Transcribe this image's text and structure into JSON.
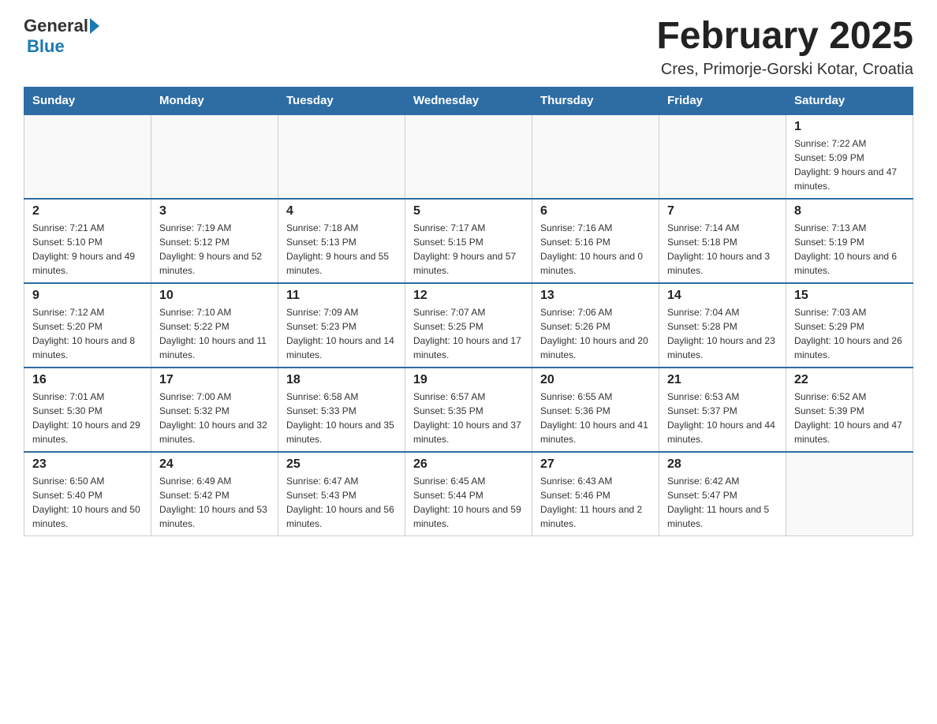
{
  "logo": {
    "text_general": "General",
    "text_blue": "Blue"
  },
  "header": {
    "title": "February 2025",
    "subtitle": "Cres, Primorje-Gorski Kotar, Croatia"
  },
  "days_of_week": [
    "Sunday",
    "Monday",
    "Tuesday",
    "Wednesday",
    "Thursday",
    "Friday",
    "Saturday"
  ],
  "weeks": [
    [
      {
        "day": "",
        "info": ""
      },
      {
        "day": "",
        "info": ""
      },
      {
        "day": "",
        "info": ""
      },
      {
        "day": "",
        "info": ""
      },
      {
        "day": "",
        "info": ""
      },
      {
        "day": "",
        "info": ""
      },
      {
        "day": "1",
        "info": "Sunrise: 7:22 AM\nSunset: 5:09 PM\nDaylight: 9 hours and 47 minutes."
      }
    ],
    [
      {
        "day": "2",
        "info": "Sunrise: 7:21 AM\nSunset: 5:10 PM\nDaylight: 9 hours and 49 minutes."
      },
      {
        "day": "3",
        "info": "Sunrise: 7:19 AM\nSunset: 5:12 PM\nDaylight: 9 hours and 52 minutes."
      },
      {
        "day": "4",
        "info": "Sunrise: 7:18 AM\nSunset: 5:13 PM\nDaylight: 9 hours and 55 minutes."
      },
      {
        "day": "5",
        "info": "Sunrise: 7:17 AM\nSunset: 5:15 PM\nDaylight: 9 hours and 57 minutes."
      },
      {
        "day": "6",
        "info": "Sunrise: 7:16 AM\nSunset: 5:16 PM\nDaylight: 10 hours and 0 minutes."
      },
      {
        "day": "7",
        "info": "Sunrise: 7:14 AM\nSunset: 5:18 PM\nDaylight: 10 hours and 3 minutes."
      },
      {
        "day": "8",
        "info": "Sunrise: 7:13 AM\nSunset: 5:19 PM\nDaylight: 10 hours and 6 minutes."
      }
    ],
    [
      {
        "day": "9",
        "info": "Sunrise: 7:12 AM\nSunset: 5:20 PM\nDaylight: 10 hours and 8 minutes."
      },
      {
        "day": "10",
        "info": "Sunrise: 7:10 AM\nSunset: 5:22 PM\nDaylight: 10 hours and 11 minutes."
      },
      {
        "day": "11",
        "info": "Sunrise: 7:09 AM\nSunset: 5:23 PM\nDaylight: 10 hours and 14 minutes."
      },
      {
        "day": "12",
        "info": "Sunrise: 7:07 AM\nSunset: 5:25 PM\nDaylight: 10 hours and 17 minutes."
      },
      {
        "day": "13",
        "info": "Sunrise: 7:06 AM\nSunset: 5:26 PM\nDaylight: 10 hours and 20 minutes."
      },
      {
        "day": "14",
        "info": "Sunrise: 7:04 AM\nSunset: 5:28 PM\nDaylight: 10 hours and 23 minutes."
      },
      {
        "day": "15",
        "info": "Sunrise: 7:03 AM\nSunset: 5:29 PM\nDaylight: 10 hours and 26 minutes."
      }
    ],
    [
      {
        "day": "16",
        "info": "Sunrise: 7:01 AM\nSunset: 5:30 PM\nDaylight: 10 hours and 29 minutes."
      },
      {
        "day": "17",
        "info": "Sunrise: 7:00 AM\nSunset: 5:32 PM\nDaylight: 10 hours and 32 minutes."
      },
      {
        "day": "18",
        "info": "Sunrise: 6:58 AM\nSunset: 5:33 PM\nDaylight: 10 hours and 35 minutes."
      },
      {
        "day": "19",
        "info": "Sunrise: 6:57 AM\nSunset: 5:35 PM\nDaylight: 10 hours and 37 minutes."
      },
      {
        "day": "20",
        "info": "Sunrise: 6:55 AM\nSunset: 5:36 PM\nDaylight: 10 hours and 41 minutes."
      },
      {
        "day": "21",
        "info": "Sunrise: 6:53 AM\nSunset: 5:37 PM\nDaylight: 10 hours and 44 minutes."
      },
      {
        "day": "22",
        "info": "Sunrise: 6:52 AM\nSunset: 5:39 PM\nDaylight: 10 hours and 47 minutes."
      }
    ],
    [
      {
        "day": "23",
        "info": "Sunrise: 6:50 AM\nSunset: 5:40 PM\nDaylight: 10 hours and 50 minutes."
      },
      {
        "day": "24",
        "info": "Sunrise: 6:49 AM\nSunset: 5:42 PM\nDaylight: 10 hours and 53 minutes."
      },
      {
        "day": "25",
        "info": "Sunrise: 6:47 AM\nSunset: 5:43 PM\nDaylight: 10 hours and 56 minutes."
      },
      {
        "day": "26",
        "info": "Sunrise: 6:45 AM\nSunset: 5:44 PM\nDaylight: 10 hours and 59 minutes."
      },
      {
        "day": "27",
        "info": "Sunrise: 6:43 AM\nSunset: 5:46 PM\nDaylight: 11 hours and 2 minutes."
      },
      {
        "day": "28",
        "info": "Sunrise: 6:42 AM\nSunset: 5:47 PM\nDaylight: 11 hours and 5 minutes."
      },
      {
        "day": "",
        "info": ""
      }
    ]
  ]
}
